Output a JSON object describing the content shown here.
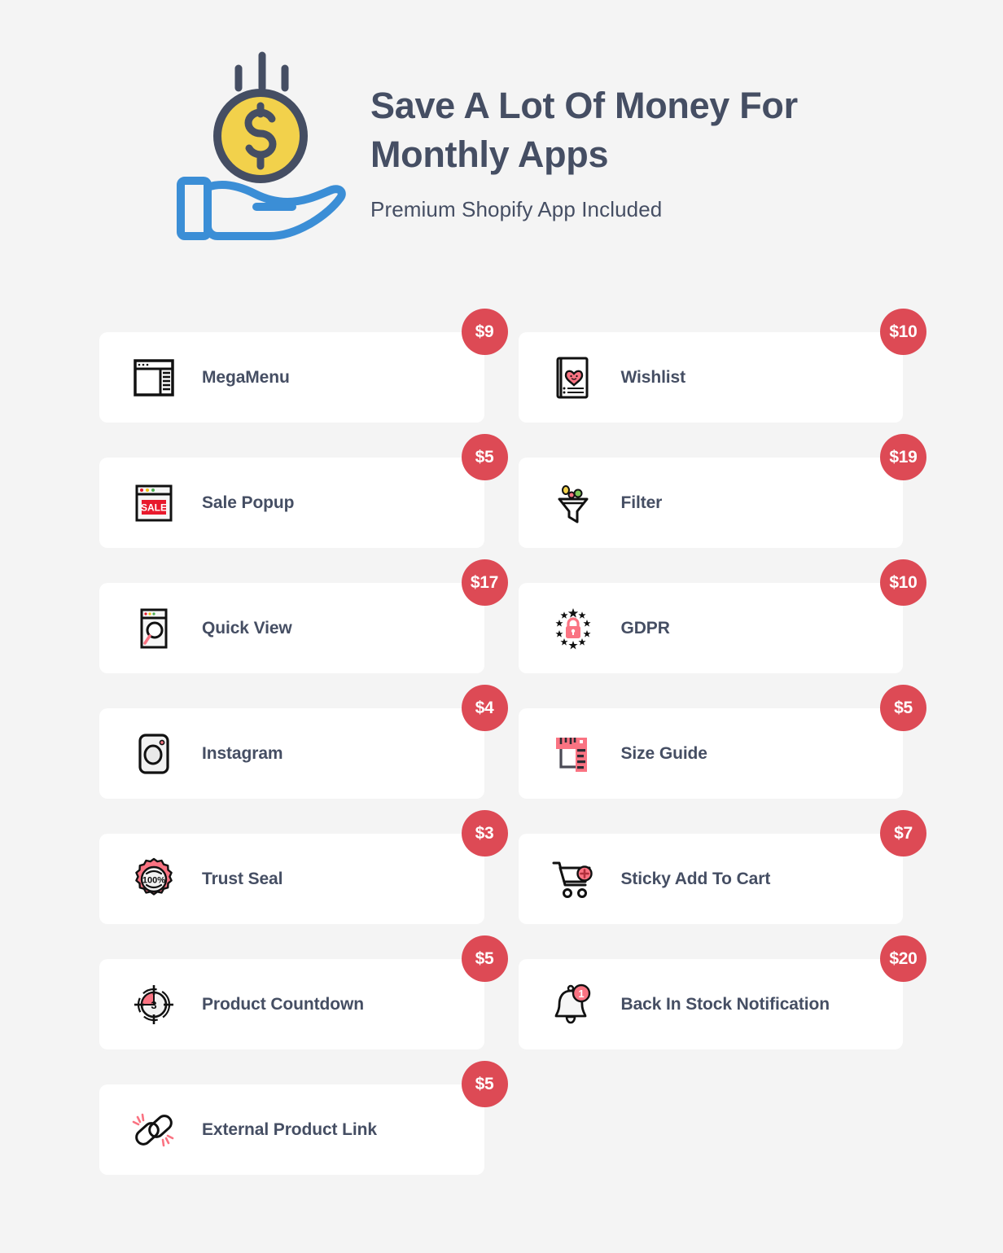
{
  "header": {
    "title": "Save A Lot Of Money For Monthly Apps",
    "subtitle": "Premium Shopify App Included",
    "icon": "hand-holding-coin-icon"
  },
  "colors": {
    "background": "#f4f4f4",
    "card": "#ffffff",
    "badge": "#dd4a55",
    "text": "#454e63",
    "accent_blue": "#3b8ed6",
    "accent_yellow": "#f2d14b",
    "accent_pink": "#fa7382"
  },
  "apps": [
    {
      "label": "MegaMenu",
      "price": "$9",
      "icon": "megamenu-icon"
    },
    {
      "label": "Wishlist",
      "price": "$10",
      "icon": "wishlist-icon"
    },
    {
      "label": "Sale Popup",
      "price": "$5",
      "icon": "sale-popup-icon"
    },
    {
      "label": "Filter",
      "price": "$19",
      "icon": "filter-funnel-icon"
    },
    {
      "label": "Quick View",
      "price": "$17",
      "icon": "quick-view-icon"
    },
    {
      "label": "GDPR",
      "price": "$10",
      "icon": "gdpr-lock-icon"
    },
    {
      "label": "Instagram",
      "price": "$4",
      "icon": "instagram-icon"
    },
    {
      "label": "Size Guide",
      "price": "$5",
      "icon": "size-guide-ruler-icon"
    },
    {
      "label": "Trust Seal",
      "price": "$3",
      "icon": "trust-seal-icon"
    },
    {
      "label": "Sticky Add To Cart",
      "price": "$7",
      "icon": "shopping-cart-plus-icon"
    },
    {
      "label": "Product Countdown",
      "price": "$5",
      "icon": "countdown-timer-icon"
    },
    {
      "label": "Back In Stock Notification",
      "price": "$20",
      "icon": "bell-notification-icon"
    },
    {
      "label": "External Product Link",
      "price": "$5",
      "icon": "broken-chain-link-icon"
    }
  ]
}
